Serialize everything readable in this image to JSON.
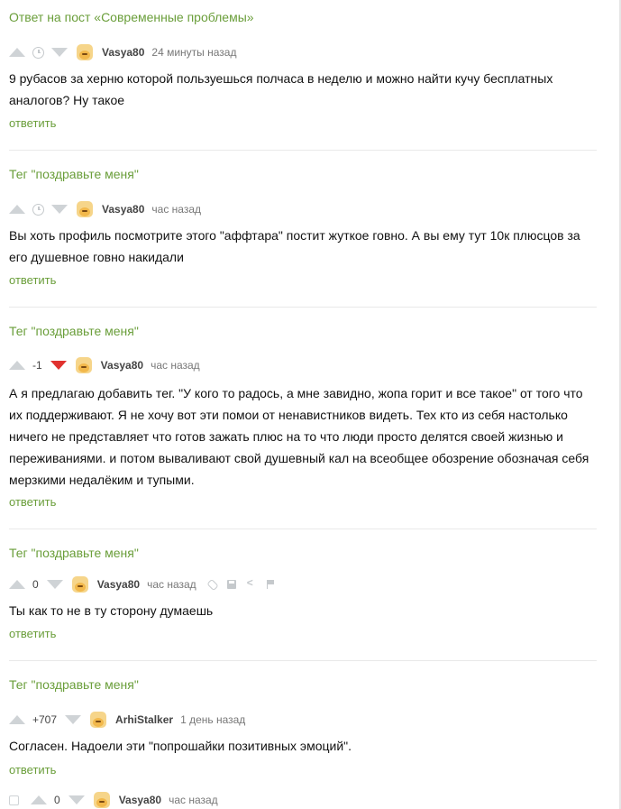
{
  "comments": [
    {
      "context": "Ответ на пост «Современные проблемы»",
      "rating": "",
      "author": "Vasya80",
      "time": "24 минуты назад",
      "text": "9 рубасов за херню которой пользуешься полчаса в неделю и можно найти кучу бесплатных аналогов? Ну такое",
      "reply": "ответить"
    },
    {
      "context": "Тег \"поздравьте меня\"",
      "rating": "",
      "author": "Vasya80",
      "time": "час назад",
      "text": "Вы хоть профиль посмотрите этого \"аффтара\" постит жуткое говно. А вы ему тут 10к плюсцов за его душевное говно накидали",
      "reply": "ответить"
    },
    {
      "context": "Тег \"поздравьте меня\"",
      "rating": "-1",
      "author": "Vasya80",
      "time": "час назад",
      "text": "А я предлагаю добавить тег. \"У кого то радось, а мне завидно, жопа горит и все такое\" от того что их поддерживают. Я не хочу вот эти помои от ненавистников видеть. Тех кто из себя настолько ничего не представляет что готов зажать плюс на то что люди просто делятся своей жизнью и переживаниями. и потом вываливают свой душевный кал на всеобщее обозрение обозначая себя мерзкими недалёким и тупыми.",
      "reply": "ответить"
    },
    {
      "context": "Тег \"поздравьте меня\"",
      "rating": "0",
      "author": "Vasya80",
      "time": "час назад",
      "text": "Ты как то не в ту сторону думаешь",
      "reply": "ответить"
    },
    {
      "context": "Тег \"поздравьте меня\"",
      "rating": "+707",
      "author": "ArhiStalker",
      "time": "1 день назад",
      "text": "Согласен. Надоели эти \"попрошайки позитивных эмоций\".",
      "reply": "ответить"
    },
    {
      "context": "",
      "rating": "0",
      "author": "Vasya80",
      "time": "час назад",
      "text": "",
      "reply": ""
    }
  ],
  "colors": {
    "link": "#6a9e3a",
    "downvote_active": "#e0312e",
    "muted_icon": "#cfd3d6"
  }
}
